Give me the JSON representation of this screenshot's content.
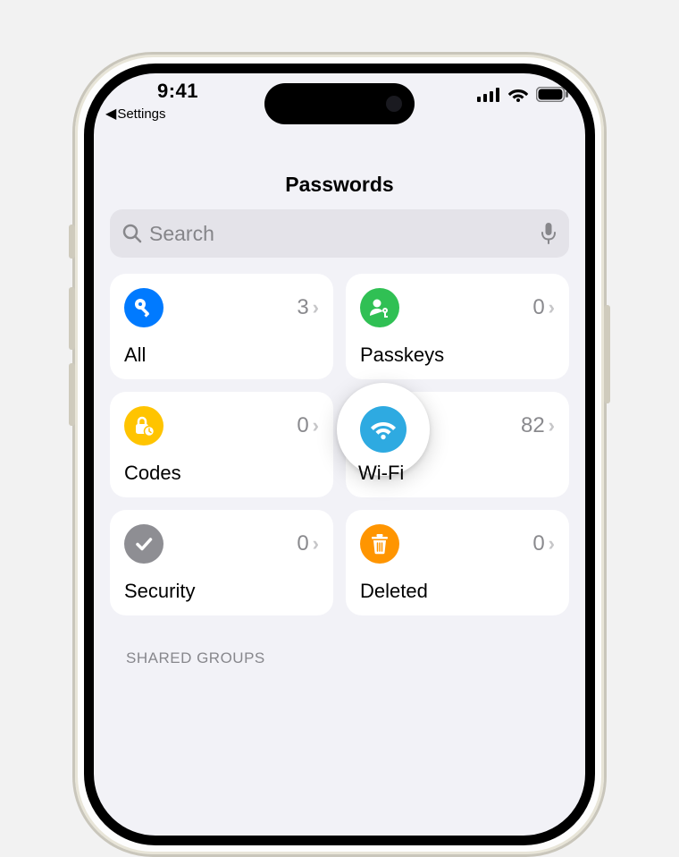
{
  "status": {
    "time": "9:41",
    "back_label": "Settings"
  },
  "header": {
    "title": "Passwords"
  },
  "search": {
    "placeholder": "Search"
  },
  "cards": {
    "all": {
      "label": "All",
      "count": "3"
    },
    "passkeys": {
      "label": "Passkeys",
      "count": "0"
    },
    "codes": {
      "label": "Codes",
      "count": "0"
    },
    "wifi": {
      "label": "Wi-Fi",
      "count": "82"
    },
    "security": {
      "label": "Security",
      "count": "0"
    },
    "deleted": {
      "label": "Deleted",
      "count": "0"
    }
  },
  "sections": {
    "shared_groups": "SHARED GROUPS"
  }
}
